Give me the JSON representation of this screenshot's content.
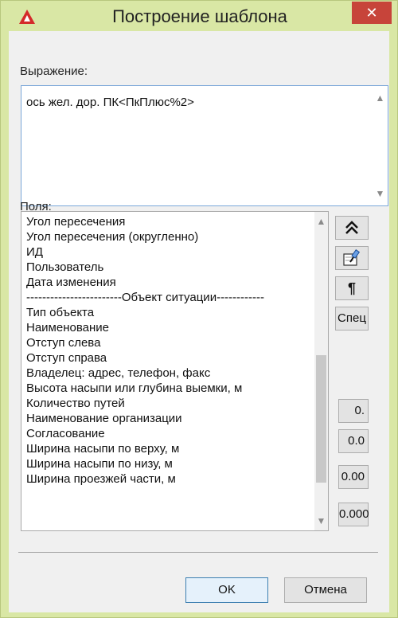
{
  "window": {
    "title": "Построение шаблона",
    "close_label": "✕"
  },
  "expression": {
    "label": "Выражение:",
    "value": "ось жел. дор. ПК<ПкПлюс%2>"
  },
  "fields": {
    "label": "Поля:",
    "items": [
      "Угол пересечения",
      "Угол пересечения (округленно)",
      "ИД",
      "Пользователь",
      "Дата изменения",
      "------------------------Объект ситуации------------",
      "Тип объекта",
      "Наименование",
      "Отступ слева",
      "Отступ справа",
      "Владелец: адрес, телефон, факс",
      "Высота насыпи или глубина выемки, м",
      "Количество путей",
      "Наименование организации",
      "Согласование",
      "Ширина насыпи по верху, м",
      "Ширина насыпи по низу, м",
      "Ширина проезжей части, м"
    ]
  },
  "side_buttons": {
    "insert_icon": "double-chevron-up-icon",
    "pick_icon": "pick-object-icon",
    "paragraph_label": "¶",
    "special_label": "Спец",
    "format0": "0.",
    "format1": "0.0",
    "format2": "0.00",
    "format3": "0.000"
  },
  "footer": {
    "ok_label": "OK",
    "cancel_label": "Отмена"
  }
}
